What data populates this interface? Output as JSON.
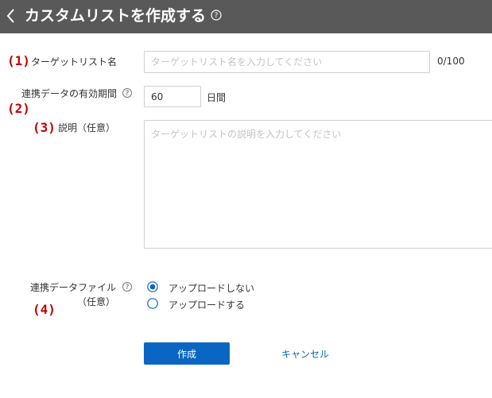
{
  "header": {
    "back_icon": "chevron-left-icon",
    "title": "カスタムリストを作成する",
    "help_icon": "help-circle-icon"
  },
  "annotations": [
    "(1)",
    "(2)",
    "(3)",
    "(4)"
  ],
  "form": {
    "list_name": {
      "label": "ターゲットリスト名",
      "placeholder": "ターゲットリスト名を入力してください",
      "value": "",
      "counter": "0/100"
    },
    "retention": {
      "label": "連携データの有効期間",
      "value": "60",
      "unit": "日間"
    },
    "description": {
      "label": "説明（任意）",
      "placeholder": "ターゲットリストの説明を入力してください",
      "value": ""
    },
    "file": {
      "label_line1": "連携データファイル",
      "label_line2": "（任意）",
      "options": [
        "アップロードしない",
        "アップロードする"
      ],
      "selected": "アップロードしない"
    }
  },
  "actions": {
    "create_label": "作成",
    "cancel_label": "キャンセル"
  },
  "colors": {
    "header_bg": "#595959",
    "accent": "#0a66c2",
    "annotation": "#c00000"
  }
}
